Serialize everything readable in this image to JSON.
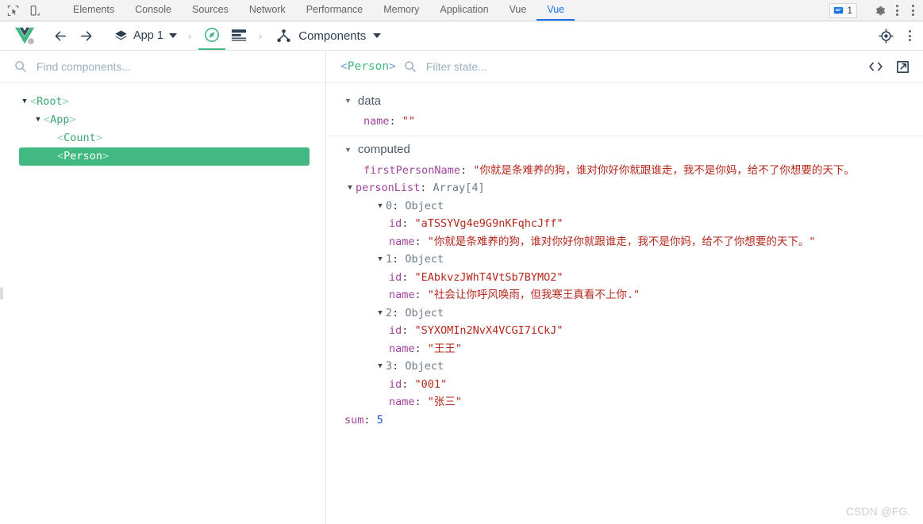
{
  "devtools": {
    "icons": {
      "inspect": "inspect-element-icon",
      "device": "device-toolbar-icon",
      "messages": "messages-icon",
      "settings": "gear-icon",
      "more": "more-options-icon"
    },
    "tabs": [
      {
        "label": "Elements",
        "active": false
      },
      {
        "label": "Console",
        "active": false
      },
      {
        "label": "Sources",
        "active": false
      },
      {
        "label": "Network",
        "active": false
      },
      {
        "label": "Performance",
        "active": false
      },
      {
        "label": "Memory",
        "active": false
      },
      {
        "label": "Application",
        "active": false
      },
      {
        "label": "Vue",
        "active": false
      },
      {
        "label": "Vue",
        "active": true
      }
    ],
    "issues_count": "1"
  },
  "vuebar": {
    "logo": "vue-logo",
    "back": "back-arrow-icon",
    "forward": "forward-arrow-icon",
    "app_label": "App 1",
    "app_icon": "layers-icon",
    "separator": "›",
    "tab_components_icon": "compass-icon",
    "tab_timeline_icon": "timeline-icon",
    "pane_title": "Components",
    "pane_icon": "component-tree-icon",
    "target_icon": "select-component-icon",
    "more_icon": "more-options-icon"
  },
  "left": {
    "search_placeholder": "Find components...",
    "search_value": "",
    "search_icon": "search-icon",
    "tree": [
      {
        "name": "Root",
        "depth": 0,
        "expanded": true,
        "has_children": true,
        "selected": false
      },
      {
        "name": "App",
        "depth": 1,
        "expanded": true,
        "has_children": true,
        "selected": false
      },
      {
        "name": "Count",
        "depth": 2,
        "expanded": false,
        "has_children": false,
        "selected": false
      },
      {
        "name": "Person",
        "depth": 2,
        "expanded": false,
        "has_children": false,
        "selected": true
      }
    ]
  },
  "right": {
    "selected_component": "Person",
    "bracket_open": "<",
    "bracket_close": ">",
    "filter_placeholder": "Filter state...",
    "filter_value": "",
    "search_icon": "search-icon",
    "code_icon": "code-brackets-icon",
    "popout_icon": "open-in-new-icon",
    "groups": [
      {
        "title": "data",
        "expanded": true
      },
      {
        "title": "computed",
        "expanded": true
      }
    ],
    "data_rows": [
      {
        "key": "name",
        "value": "\"\"",
        "type": "string",
        "indent": 1
      }
    ],
    "computed_rows": [
      {
        "key": "firstPersonName",
        "value": "\"你就是条难养的狗，谁对你好你就跟谁走，我不是你妈，给不了你想要的天下。",
        "type": "string",
        "indent": 1,
        "truncated": true
      },
      {
        "key": "personList",
        "value": "Array[4]",
        "type": "type",
        "indent": 0,
        "tri": "▼"
      },
      {
        "key": "0",
        "value": "Object",
        "type": "type",
        "indent": 1,
        "tri": "▼",
        "plain_key": true
      },
      {
        "key": "id",
        "value": "\"aTSSYVg4e9G9nKFqhcJff\"",
        "type": "string",
        "indent": 3
      },
      {
        "key": "name",
        "value": "\"你就是条难养的狗，谁对你好你就跟谁走，我不是你妈，给不了你想要的天下。\"",
        "type": "string",
        "indent": 3
      },
      {
        "key": "1",
        "value": "Object",
        "type": "type",
        "indent": 1,
        "tri": "▼",
        "plain_key": true
      },
      {
        "key": "id",
        "value": "\"EAbkvzJWhT4VtSb7BYMO2\"",
        "type": "string",
        "indent": 3
      },
      {
        "key": "name",
        "value": "\"社会让你呼风唤雨，但我寒王真看不上你.\"",
        "type": "string",
        "indent": 3
      },
      {
        "key": "2",
        "value": "Object",
        "type": "type",
        "indent": 1,
        "tri": "▼",
        "plain_key": true
      },
      {
        "key": "id",
        "value": "\"SYXOMIn2NvX4VCGI7iCkJ\"",
        "type": "string",
        "indent": 3
      },
      {
        "key": "name",
        "value": "\"王王\"",
        "type": "string",
        "indent": 3
      },
      {
        "key": "3",
        "value": "Object",
        "type": "type",
        "indent": 1,
        "tri": "▼",
        "plain_key": true
      },
      {
        "key": "id",
        "value": "\"001\"",
        "type": "string",
        "indent": 3
      },
      {
        "key": "name",
        "value": "\"张三\"",
        "type": "string",
        "indent": 3
      },
      {
        "key": "sum",
        "value": "5",
        "type": "number",
        "indent": 0
      }
    ]
  },
  "watermark": "CSDN @FG.",
  "colors": {
    "vue_green": "#42b883",
    "devtools_blue": "#1a73e8",
    "string_red": "#b5281c",
    "key_purple": "#a0439c",
    "number_blue": "#1a4bd6"
  }
}
